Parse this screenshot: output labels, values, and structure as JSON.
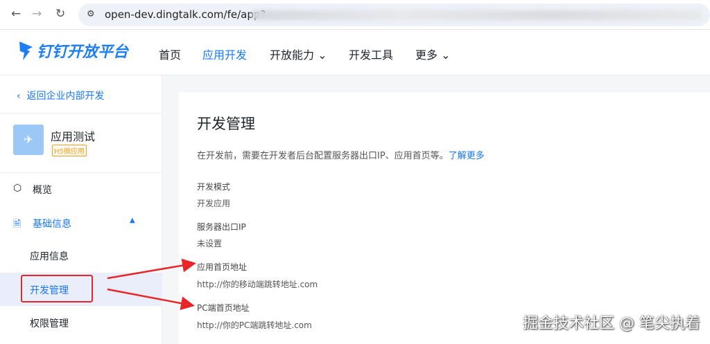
{
  "browser": {
    "url": "open-dev.dingtalk.com/fe/app?"
  },
  "header": {
    "logo": "钉钉开放平台",
    "menu": [
      {
        "label": "首页"
      },
      {
        "label": "应用开发"
      },
      {
        "label": "开放能力"
      },
      {
        "label": "开发工具"
      },
      {
        "label": "更多"
      }
    ]
  },
  "sidebar": {
    "back": "返回企业内部开发",
    "app_name": "应用测试",
    "app_badge": "H5微应用",
    "items": [
      {
        "label": "概览"
      },
      {
        "label": "基础信息"
      },
      {
        "label": "应用信息"
      },
      {
        "label": "开发管理"
      },
      {
        "label": "权限管理"
      }
    ]
  },
  "main": {
    "title": "开发管理",
    "desc": "在开发前，需要在开发者后台配置服务器出口IP、应用首页等。",
    "desc_link": "了解更多",
    "fields": [
      {
        "label": "开发模式",
        "value": "开发应用"
      },
      {
        "label": "服务器出口IP",
        "value": "未设置"
      },
      {
        "label": "应用首页地址",
        "value": "http://你的移动端跳转地址.com"
      },
      {
        "label": "PC端首页地址",
        "value": "http://你的PC端跳转地址.com"
      }
    ]
  },
  "watermark": "掘金技术社区 @ 笔尖执着",
  "colors": {
    "accent": "#1677ff",
    "annotation": "#e8262a"
  }
}
